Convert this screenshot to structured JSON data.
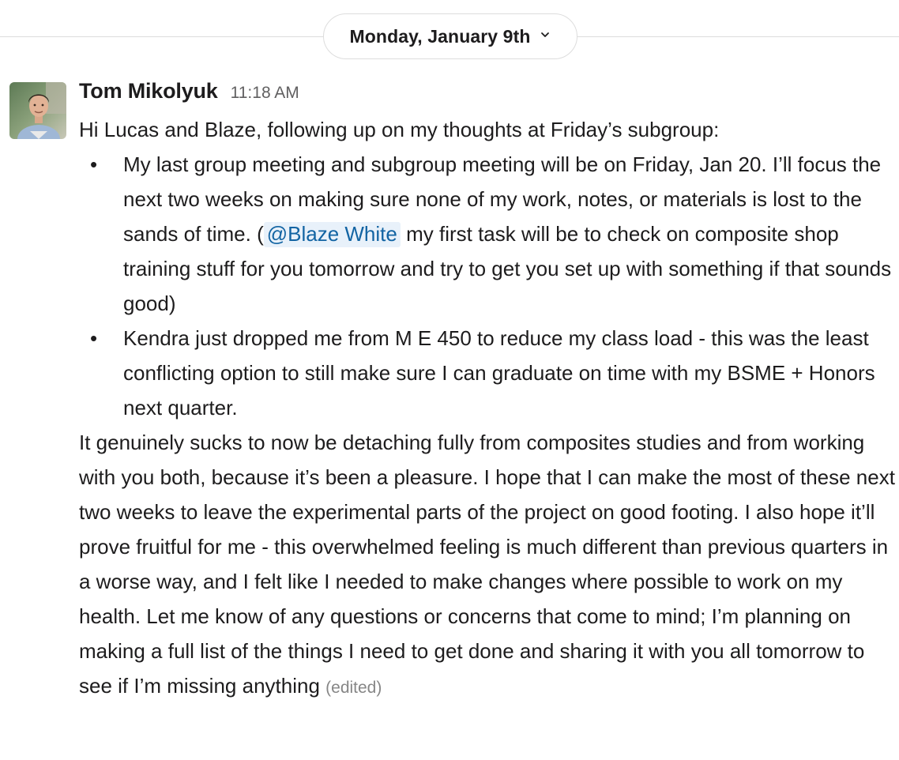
{
  "date_divider": {
    "label": "Monday, January 9th",
    "chevron_icon": "chevron-down-icon"
  },
  "message": {
    "sender": "Tom Mikolyuk",
    "timestamp": "11:18 AM",
    "avatar_icon": "user-avatar-photo",
    "intro": "Hi Lucas and Blaze, following up on my thoughts at Friday’s subgroup:",
    "bullets": [
      {
        "marker": "•",
        "text_before": "My last group meeting and subgroup meeting will be on Friday, Jan 20. I’ll focus the next two weeks on making sure none of my work, notes, or materials is lost to the sands of time. (",
        "mention": "@Blaze White",
        "text_after": " my first task will be to check on composite shop training stuff for you tomorrow and try to get you set up with something if that sounds good)"
      },
      {
        "marker": "•",
        "text": "Kendra just dropped me from M E 450 to reduce my class load - this was the least conflicting option to still make sure I can graduate on time with my BSME + Honors next quarter."
      }
    ],
    "closing": "It genuinely sucks to now be detaching fully from composites studies and from working with you both, because it’s been a pleasure. I hope that I can make the most of these next two weeks to leave the experimental parts of the project on good footing. I also hope it’ll prove fruitful for me - this overwhelmed feeling is much different than previous quarters in a worse way, and I felt like I needed to make changes where possible to work on my health. Let me know of any questions or concerns that come to mind; I’m planning on making a full list of the things I need to get done and sharing it with you all tomorrow to see if I’m missing anything",
    "edited_label": "(edited)"
  },
  "colors": {
    "text": "#1d1c1d",
    "timestamp": "#616061",
    "edited": "#868686",
    "mention_text": "#1264a3",
    "mention_bg": "#e8f1fa",
    "divider": "#dddddd"
  }
}
